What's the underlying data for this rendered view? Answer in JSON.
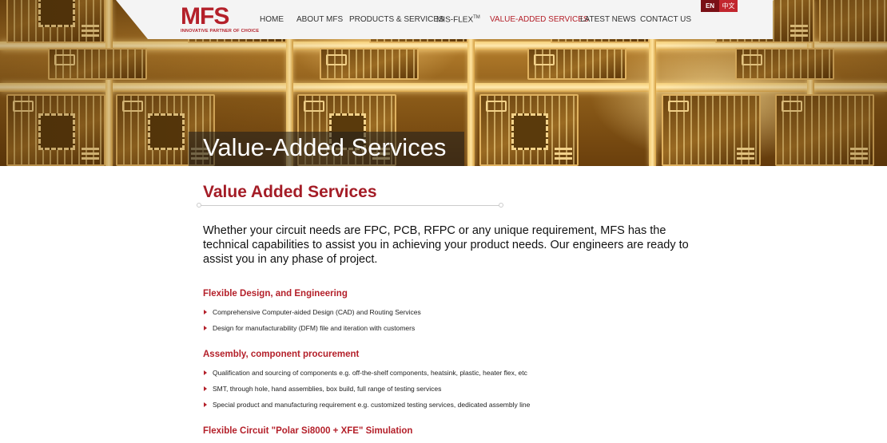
{
  "header": {
    "logo_text": "MFS",
    "logo_tagline": "INNOVATIVE PARTNER OF CHOICE",
    "nav": [
      {
        "label": "HOME"
      },
      {
        "label": "ABOUT MFS"
      },
      {
        "label": "PRODUCTS & SERVICES"
      },
      {
        "label": "MIS-FLEX"
      },
      {
        "label": "VALUE-ADDED SERVICES",
        "active": true
      },
      {
        "label": "LATEST NEWS"
      },
      {
        "label": "CONTACT US"
      }
    ],
    "nav_tm": "TM",
    "lang_en": "EN",
    "lang_zh": "中文"
  },
  "hero": {
    "title": "Value-Added Services"
  },
  "content": {
    "title": "Value Added Services",
    "intro": "Whether your circuit needs are FPC, PCB, RFPC or any unique requirement, MFS has the technical capabilities to assist you in achieving your product needs. Our engineers are ready to assist you in any phase of project.",
    "sections": [
      {
        "heading": "Flexible Design, and Engineering",
        "items": [
          "Comprehensive Computer-aided Design (CAD) and Routing Services",
          "Design for manufacturability (DFM) file and iteration with customers"
        ]
      },
      {
        "heading": "Assembly, component procurement",
        "items": [
          "Qualification and sourcing of components e.g. off-the-shelf components, heatsink, plastic, heater flex, etc",
          "SMT, through hole, hand assemblies, box build, full range of testing services",
          "Special product and manufacturing requirement e.g. customized testing services, dedicated assembly line"
        ]
      },
      {
        "heading": "Flexible Circuit \"Polar Si8000 + XFE\" Simulation",
        "items": []
      }
    ]
  },
  "colors": {
    "brand_red": "#b4202a",
    "nav_bg": "#f4f4f4"
  }
}
